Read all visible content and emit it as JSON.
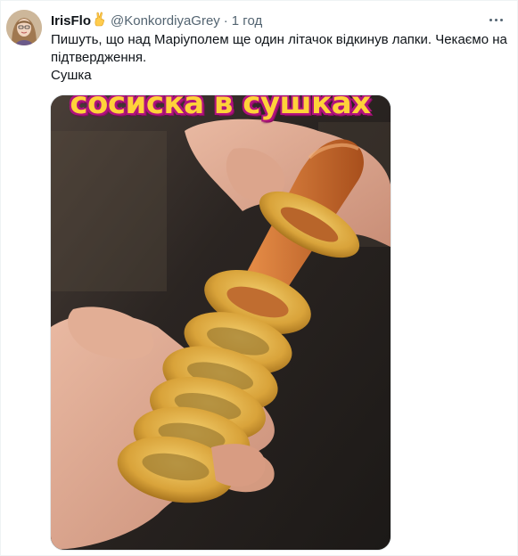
{
  "author": {
    "display_name": "IrisFlo",
    "emoji": "victory-hand-emoji",
    "handle": "@KonkordiyaGrey",
    "separator": "·",
    "timestamp": "1 год"
  },
  "tweet": {
    "text_line_1": "Пишуть, що над Маріуполем ще один літачок відкинув лапки. Чекаємо на підтвердження.",
    "text_line_2": "Сушка"
  },
  "media": {
    "banner_text": "сосиска в сушках",
    "icon": "sausage-with-bagels-photo"
  },
  "colors": {
    "text_primary": "#0f1419",
    "text_secondary": "#536471",
    "banner_fill": "#ffd23a",
    "banner_outline": "#b0127e"
  }
}
